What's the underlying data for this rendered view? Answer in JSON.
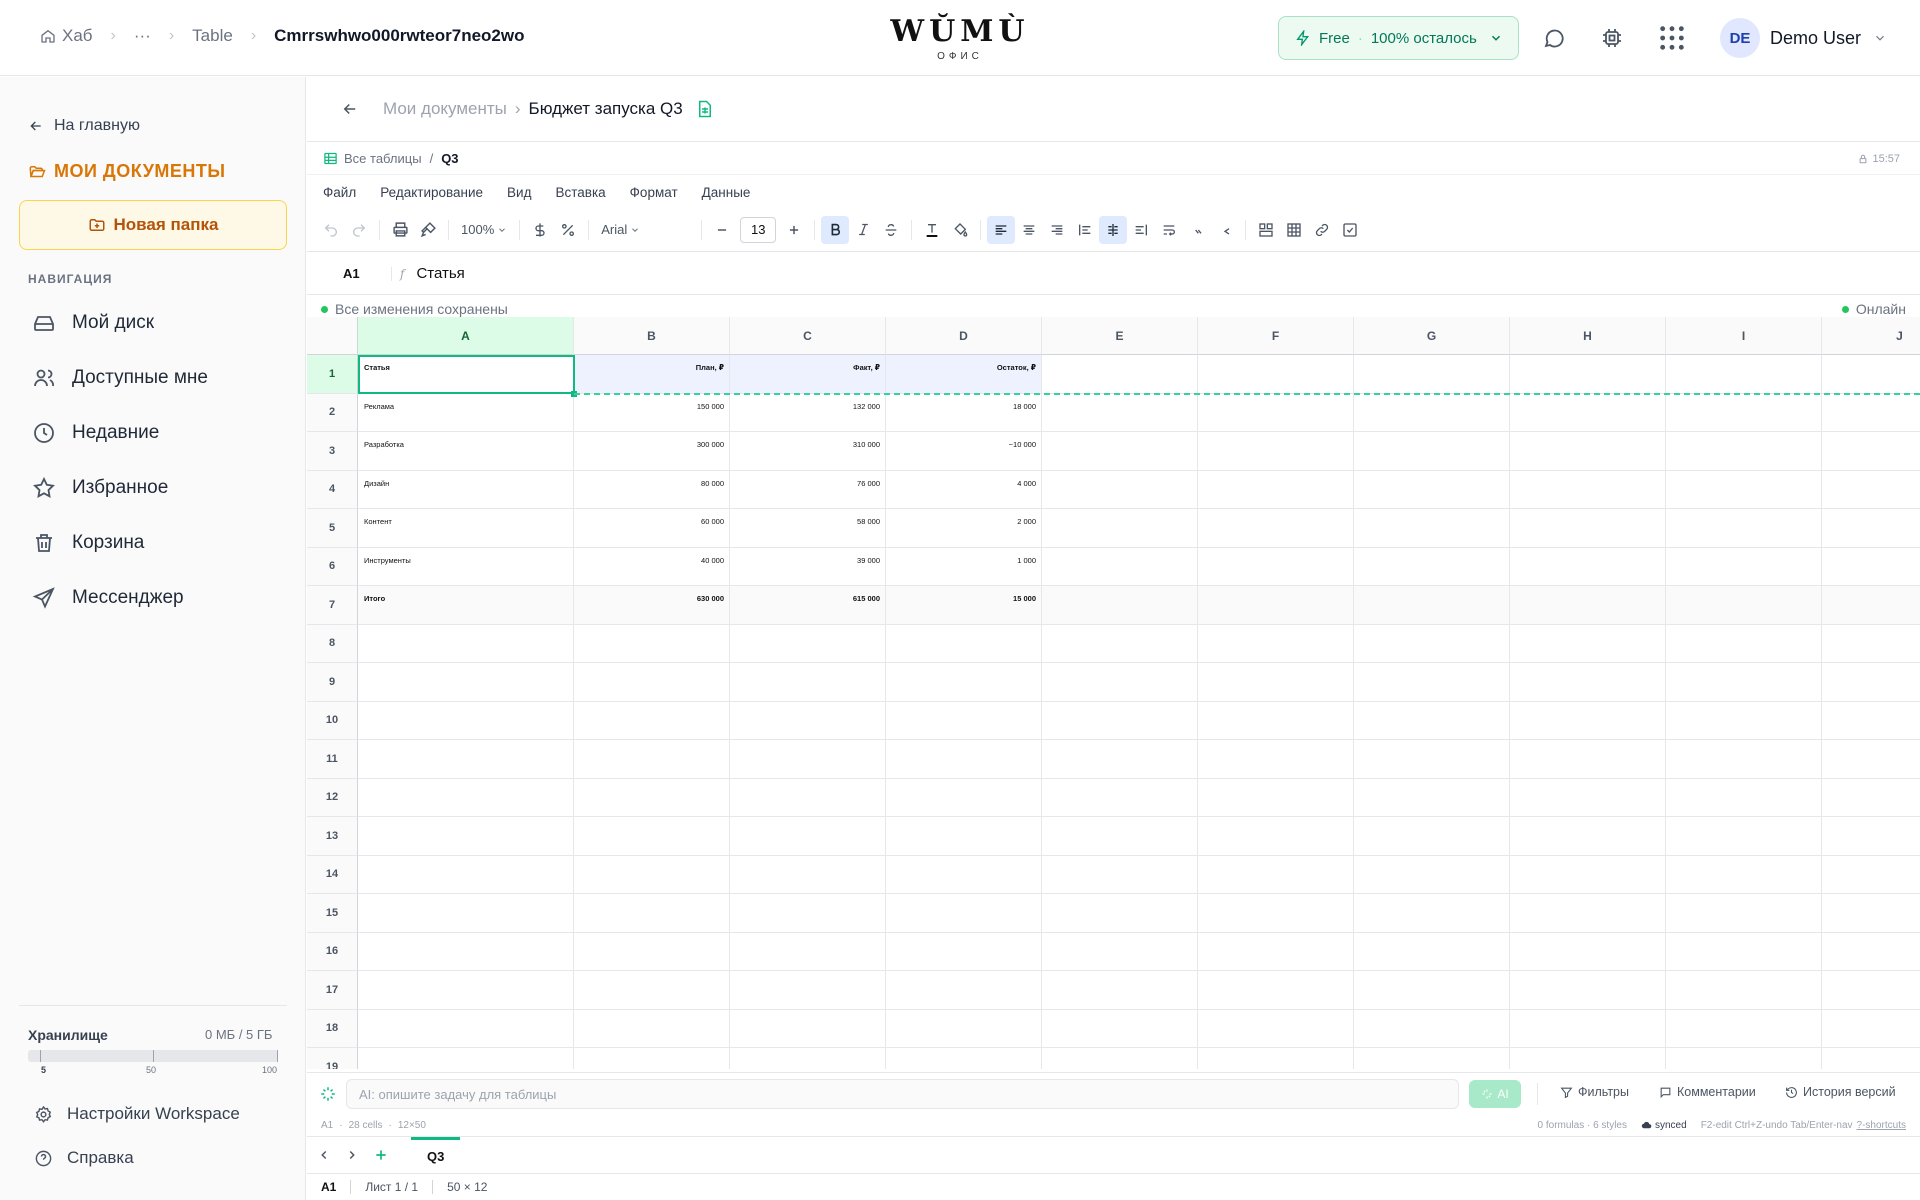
{
  "topbar": {
    "breadcrumbs": [
      "Хаб",
      "···",
      "Table",
      "Cmrrswhwo000rwteor7neo2wo"
    ],
    "brand_word": "WŬMÙ",
    "brand_sub": "ОФИС",
    "plan_name": "Free",
    "plan_quota": "100% осталось",
    "user_initials": "DE",
    "user_name": "Demo User"
  },
  "sidebar": {
    "back_label": "На главную",
    "section_title": "МОИ ДОКУМЕНТЫ",
    "new_folder": "Новая папка",
    "nav_heading": "НАВИГАЦИЯ",
    "items": [
      {
        "label": "Мой диск",
        "icon": "drive-icon"
      },
      {
        "label": "Доступные мне",
        "icon": "users-icon"
      },
      {
        "label": "Недавние",
        "icon": "clock-icon"
      },
      {
        "label": "Избранное",
        "icon": "star-icon"
      },
      {
        "label": "Корзина",
        "icon": "trash-icon"
      },
      {
        "label": "Мессенджер",
        "icon": "send-icon"
      }
    ],
    "storage_label": "Хранилище",
    "storage_value": "0 МБ / 5 ГБ",
    "storage_fraction": 0.0,
    "storage_ticks": [
      "5",
      "50",
      "100"
    ],
    "settings": "Настройки Workspace",
    "help": "Справка"
  },
  "doc": {
    "parent": "Мои документы",
    "title": "Бюджет запуска Q3",
    "all_tables": "Все таблицы",
    "sheet_name": "Q3",
    "time": "15:57",
    "menu": [
      "Файл",
      "Редактирование",
      "Вид",
      "Вставка",
      "Формат",
      "Данные"
    ],
    "zoom": "100%",
    "font": "Arial",
    "font_size": "13",
    "cell_ref": "A1",
    "fx": "f",
    "formula_value": "Статья",
    "saved_status": "Все изменения сохранены",
    "online": "Онлайн"
  },
  "grid": {
    "columns": [
      "A",
      "B",
      "C",
      "D",
      "E",
      "F",
      "G",
      "H",
      "I",
      "J"
    ],
    "row_numbers": [
      "1",
      "2",
      "3",
      "4",
      "5",
      "6",
      "7",
      "8",
      "9",
      "10",
      "11",
      "12",
      "13",
      "14",
      "15",
      "16",
      "17",
      "18",
      "19"
    ],
    "rows": [
      [
        "Статья",
        "План, ₽",
        "Факт, ₽",
        "Остаток, ₽"
      ],
      [
        "Реклама",
        "150 000",
        "132 000",
        "18 000"
      ],
      [
        "Разработка",
        "300 000",
        "310 000",
        "−10 000"
      ],
      [
        "Дизайн",
        "80 000",
        "76 000",
        "4 000"
      ],
      [
        "Контент",
        "60 000",
        "58 000",
        "2 000"
      ],
      [
        "Инструменты",
        "40 000",
        "39 000",
        "1 000"
      ],
      [
        "Итого",
        "630 000",
        "615 000",
        "15 000"
      ]
    ]
  },
  "ai": {
    "placeholder": "AI: опишите задачу для таблицы",
    "button": "AI",
    "filters": "Фильтры",
    "comments": "Комментарии",
    "history": "История версий"
  },
  "info": {
    "cell": "A1",
    "cells": "28 cells",
    "dims": "12×50",
    "formulas": "0 formulas · 6 styles",
    "synced": "synced",
    "hints": "F2-edit Ctrl+Z-undo Tab/Enter-nav",
    "shortcuts": "?-shortcuts"
  },
  "footer": {
    "cell": "A1",
    "sheet": "Лист 1 / 1",
    "size": "50 × 12"
  }
}
